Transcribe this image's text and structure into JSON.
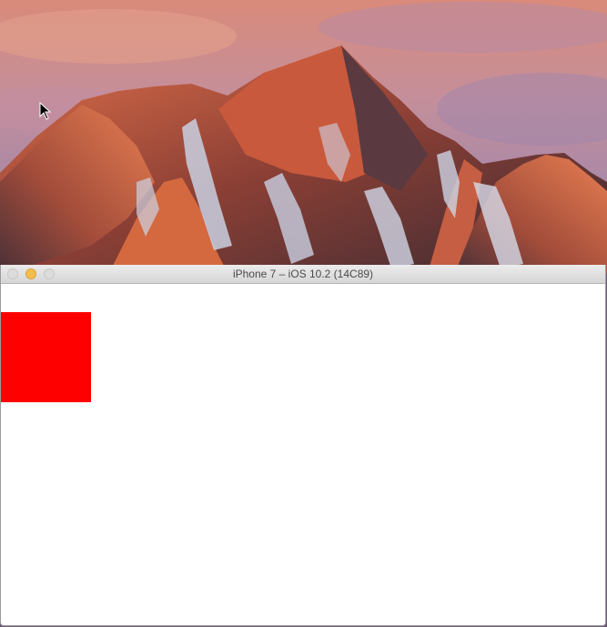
{
  "simulator": {
    "window_title": "iPhone 7 – iOS 10.2 (14C89)",
    "controls": [
      "close",
      "minimize",
      "zoom"
    ]
  },
  "app_screen": {
    "background_color": "#ffffff",
    "view_color": "#ff0000"
  },
  "icons": {
    "cursor": "arrow-cursor-icon"
  }
}
